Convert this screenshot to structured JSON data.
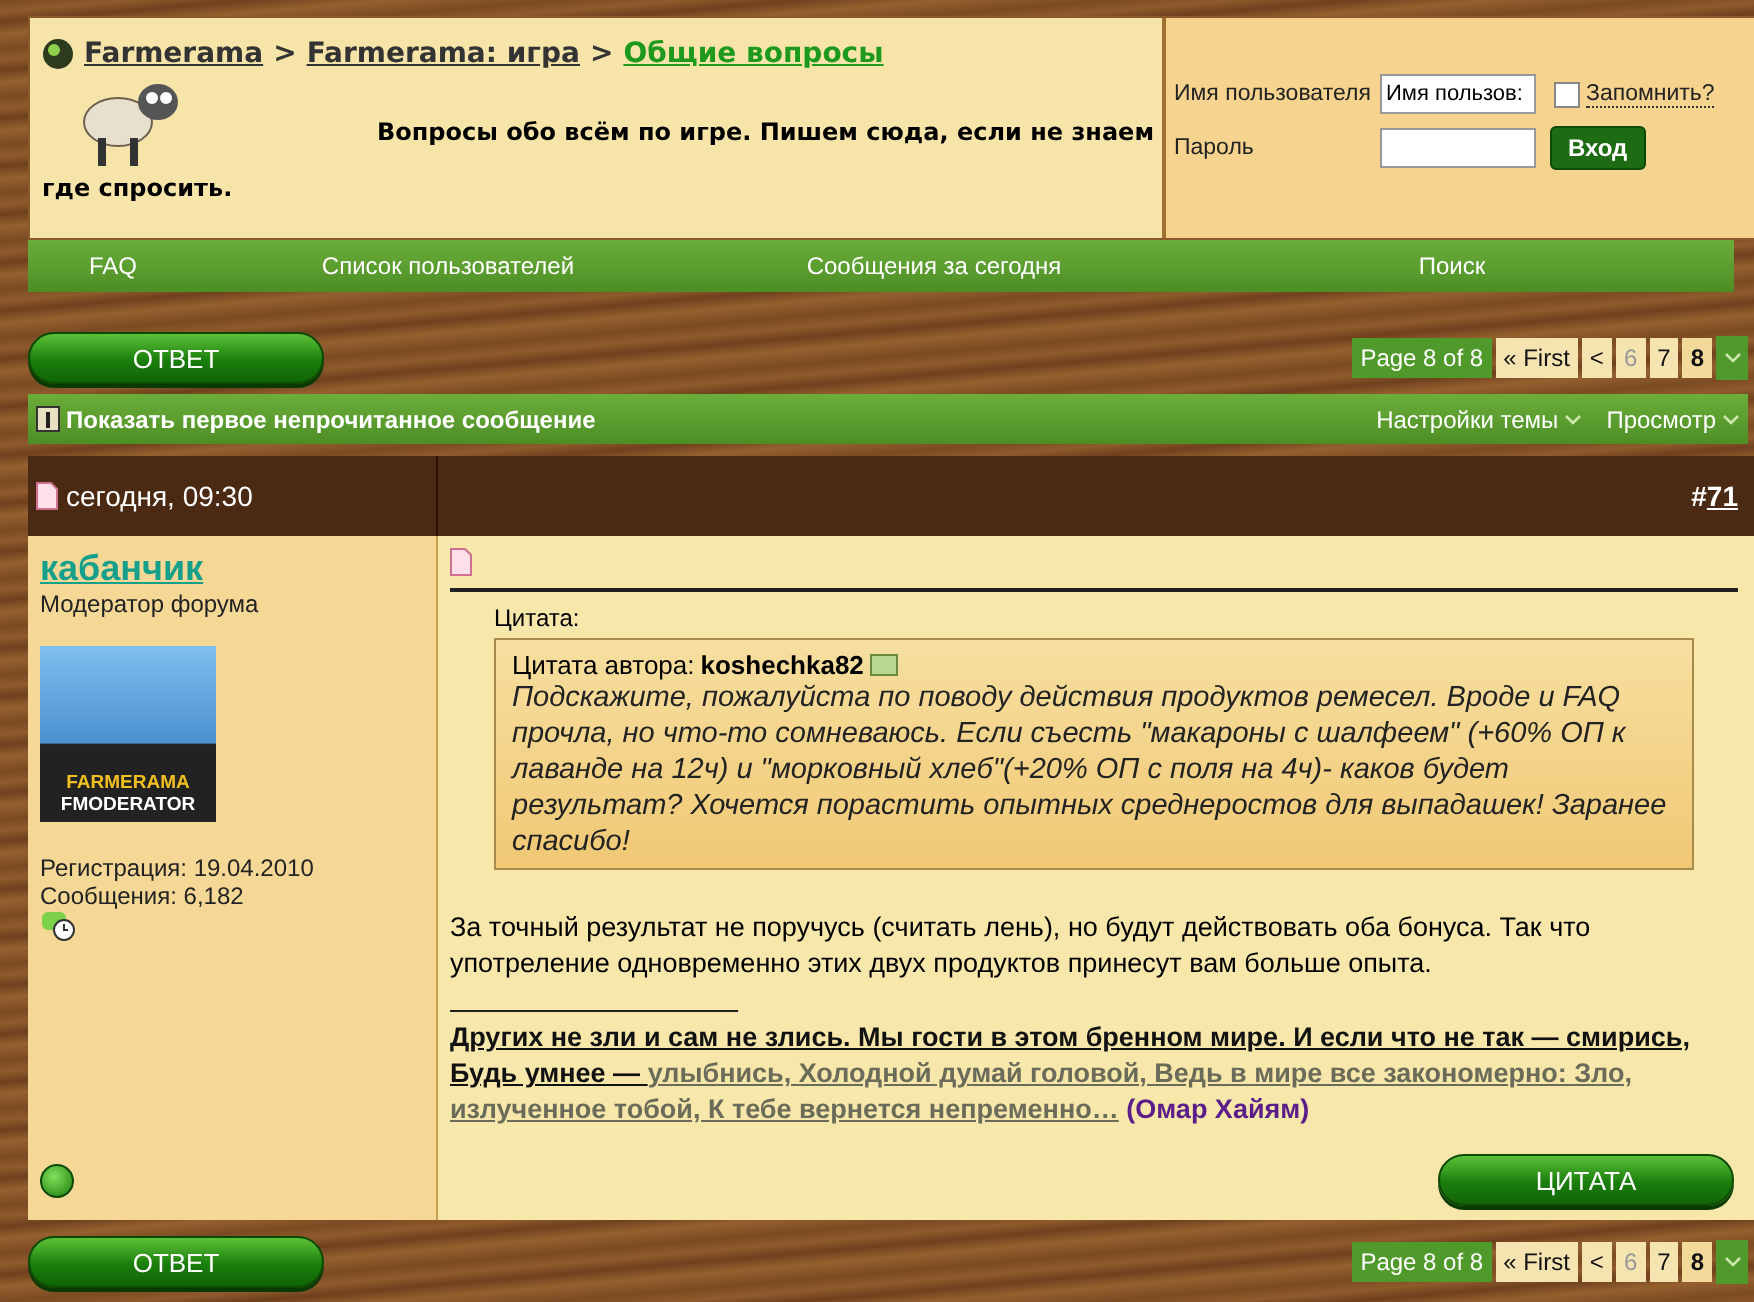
{
  "breadcrumb": [
    {
      "label": "Farmerama",
      "selected": false
    },
    {
      "label": "Farmerama: игра",
      "selected": false
    },
    {
      "label": "Общие вопросы",
      "selected": true
    }
  ],
  "breadcrumb_separator": ">",
  "forum_description": [
    "Вопросы обо всём по игре. Пишем сюда, если не знаем",
    "где спросить."
  ],
  "login": {
    "username_label": "Имя пользователя",
    "username_value": "Имя пользов:",
    "remember_label": "Запомнить?",
    "remember_checked": false,
    "password_label": "Пароль",
    "submit": "Вход"
  },
  "nav": [
    "FAQ",
    "Список пользователей",
    "Сообщения за сегодня",
    "Поиск"
  ],
  "reply_button": "ОТВЕТ",
  "pagination": {
    "label": "Page 8 of 8",
    "first": "« First",
    "prev": "<",
    "pages": [
      {
        "label": "6",
        "selected": false
      },
      {
        "label": "7",
        "selected": false
      },
      {
        "label": "8",
        "selected": true
      }
    ]
  },
  "thread_bar": {
    "first_unread": "Показать первое непрочитанное сообщение",
    "menus": [
      "Настройки темы",
      "Просмотр"
    ]
  },
  "post": {
    "date": "сегодня, 09:30",
    "number_prefix": "#",
    "number": "71",
    "author": {
      "name": "кабанчик",
      "title": "Модератор форума",
      "avatar_text_1": "FARMERAMA",
      "avatar_text_2": "FMODERATOR",
      "registration": "Регистрация:  19.04.2010",
      "posts": "Сообщения: 6,182",
      "online": true
    },
    "quote": {
      "heading": "Цитата:",
      "author_prefix": "Цитата автора:",
      "author": "koshechka82",
      "text": "Подскажите, пожалуйста по поводу действия продуктов ремесел. Вроде и FAQ прочла, но что-то сомневаюсь. Если съесть \"макароны с шалфеем\" (+60% ОП к лаванде на 12ч) и \"морковный хлеб\"(+20% ОП с поля на 4ч)- каков будет результат? Хочется порастить опытных среднеростов для выпадашек! Заранее спасибо!"
    },
    "message": "За точный результат не поручусь (считать лень), но будут действовать оба бонуса. Так что употреление одновременно этих двух продуктов принесут вам больше опыта.",
    "signature": [
      {
        "kind": "bold",
        "text": "Других не зли и сам не злись. Мы гости в этом бренном мире. И если что не так — смирись, Будь умнее — "
      },
      {
        "kind": "muted",
        "text": "улыбнись, Холодной думай головой, Ведь в мире все закономерно: Зло, излученное тобой, К тебе вернется непременно…"
      },
      {
        "kind": "attribution",
        "text": " (Омар Хайям)"
      }
    ],
    "quote_button": "ЦИТАТА"
  },
  "bottom_bar": {
    "reply_button": "ОТВЕТ",
    "pagination": {
      "label": "Page 8 of 8",
      "first": "« First",
      "prev": "<",
      "pages": [
        {
          "label": "6",
          "selected": false
        },
        {
          "label": "7",
          "selected": false
        },
        {
          "label": "8",
          "selected": true
        }
      ]
    }
  }
}
